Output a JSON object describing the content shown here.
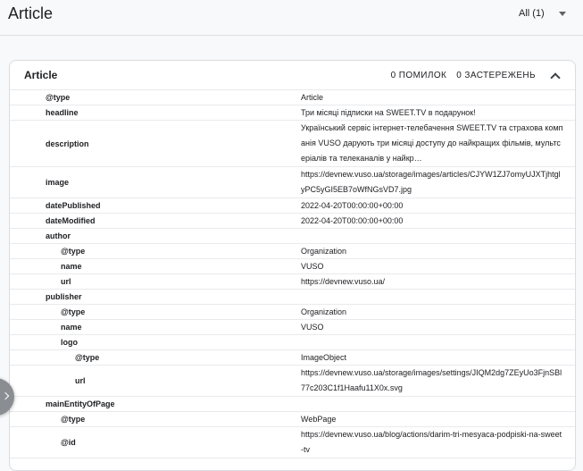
{
  "page_title": "Article",
  "filter": {
    "label": "All (1)"
  },
  "card": {
    "title": "Article",
    "errors": "0 ПОМИЛОК",
    "warnings": "0 ЗАСТЕРЕЖЕНЬ"
  },
  "rows": [
    {
      "key": "@type",
      "value": "Article",
      "depth": 0,
      "h": 17
    },
    {
      "key": "headline",
      "value": "Три місяці підписки на SWEET.TV в подарунок!",
      "depth": 0,
      "h": 17
    },
    {
      "key": "description",
      "value": "Український сервіс інтернет-телебачення SWEET.TV та страхова компанія VUSO дарують три місяці доступу до найкращих фільмів, мультсеріалів та телеканалів у найкр…",
      "depth": 0,
      "h": 52
    },
    {
      "key": "image",
      "value": "https://devnew.vuso.ua/storage/images/articles/CJYW1ZJ7omyUJXTjhtglyPC5yGI5EB7oWfNGsVD7.jpg",
      "depth": 0,
      "h": 35
    },
    {
      "key": "datePublished",
      "value": "2022-04-20T00:00:00+00:00",
      "depth": 0,
      "h": 17
    },
    {
      "key": "dateModified",
      "value": "2022-04-20T00:00:00+00:00",
      "depth": 0,
      "h": 17
    },
    {
      "key": "author",
      "value": "",
      "depth": 0,
      "h": 17
    },
    {
      "key": "@type",
      "value": "Organization",
      "depth": 1,
      "h": 17
    },
    {
      "key": "name",
      "value": "VUSO",
      "depth": 1,
      "h": 17
    },
    {
      "key": "url",
      "value": "https://devnew.vuso.ua/",
      "depth": 1,
      "h": 17
    },
    {
      "key": "publisher",
      "value": "",
      "depth": 0,
      "h": 17
    },
    {
      "key": "@type",
      "value": "Organization",
      "depth": 1,
      "h": 17
    },
    {
      "key": "name",
      "value": "VUSO",
      "depth": 1,
      "h": 17
    },
    {
      "key": "logo",
      "value": "",
      "depth": 1,
      "h": 17
    },
    {
      "key": "@type",
      "value": "ImageObject",
      "depth": 2,
      "h": 17
    },
    {
      "key": "url",
      "value": "https://devnew.vuso.ua/storage/images/settings/JIQM2dg7ZEyUo3FjnSBl77c203C1f1Haafu11X0x.svg",
      "depth": 2,
      "h": 35
    },
    {
      "key": "mainEntityOfPage",
      "value": "",
      "depth": 0,
      "h": 17
    },
    {
      "key": "@type",
      "value": "WebPage",
      "depth": 1,
      "h": 17
    },
    {
      "key": "@id",
      "value": "https://devnew.vuso.ua/blog/actions/darim-tri-mesyaca-podpiski-na-sweet-tv",
      "depth": 1,
      "h": 35
    }
  ]
}
